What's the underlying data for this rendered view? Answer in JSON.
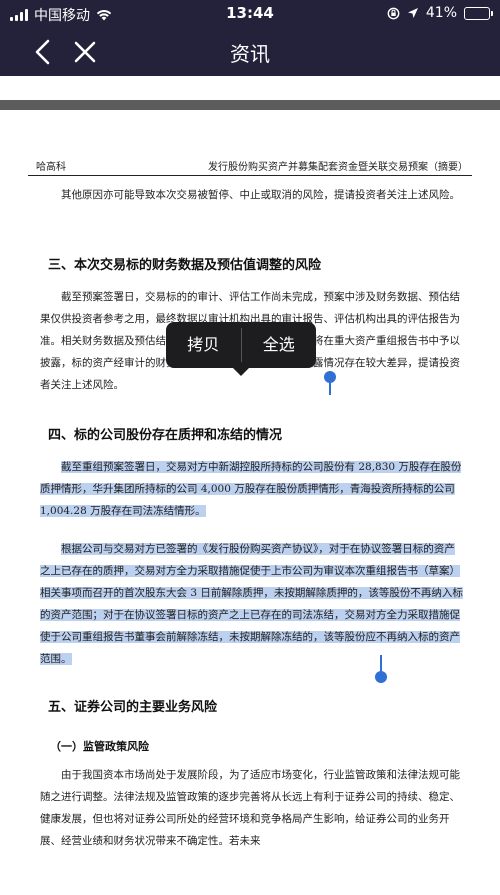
{
  "status_bar": {
    "carrier": "中国移动",
    "time": "13:44",
    "battery_percent": "41%",
    "battery_level": 0.41,
    "battery_color": "#4cd964"
  },
  "nav": {
    "title": "资讯",
    "back_icon": "chevron-left-icon",
    "close_icon": "close-icon",
    "background": "#24213a"
  },
  "document": {
    "header_left": "哈高科",
    "header_right": "发行股份购买资产并募集配套资金暨关联交易预案（摘要）",
    "p_intro": "其他原因亦可能导致本次交易被暂停、中止或取消的风险，提请投资者关注上述风险。",
    "h3": "三、本次交易标的财务数据及预估值调整的风险",
    "p3": "截至预案签署日，交易标的的审计、评估工作尚未完成，预案中涉及财务数据、预估结果仅供投资者参考之用，最终数据以审计机构出具的审计报告、评估机构出具的评估报告为准。相关财务数据及预估结果与最终审计、评估或估值结果将在重大资产重组报告书中予以披露，标的资产经审计的财务数据、评估结果可能与预案披露情况存在较大差异，提请投资者关注上述风险。",
    "h4": "四、标的公司股份存在质押和冻结的情况",
    "p4a": "截至重组预案签署日，交易对方中新湖控股所持标的公司股份有 28,830 万股存在股份质押情形，华升集团所持标的公司 4,000 万股存在股份质押情形，青海投资所持标的公司 1,004.28 万股存在司法冻结情形。",
    "p4b": "根据公司与交易对方已签署的《发行股份购买资产协议》，对于在协议签署日标的资产之上已存在的质押，交易对方全力采取措施促使于上市公司为审议本次重组报告书（草案）相关事项而召开的首次股东大会 3 日前解除质押，未按期解除质押的，该等股份不再纳入标的资产范围；对于在协议签署日标的资产之上已存在的司法冻结，交易对方全力采取措施促使于公司重组报告书董事会前解除冻结，未按期解除冻结的，该等股份应不再纳入标的资产范围。",
    "h5": "五、证券公司的主要业务风险",
    "h5_1": "（一）监管政策风险",
    "p5": "由于我国资本市场尚处于发展阶段，为了适应市场变化，行业监管政策和法律法规可能随之进行调整。法律法规及监管政策的逐步完善将从长远上有利于证券公司的持续、稳定、健康发展，但也将对证券公司所处的经营环境和竞争格局产生影响，给证券公司的业务开展、经营业绩和财务状况带来不确定性。若未来"
  },
  "context_menu": {
    "copy": "拷贝",
    "select_all": "全选"
  },
  "selection_color": "#bcd0ef",
  "handle_color": "#2f6fd6"
}
